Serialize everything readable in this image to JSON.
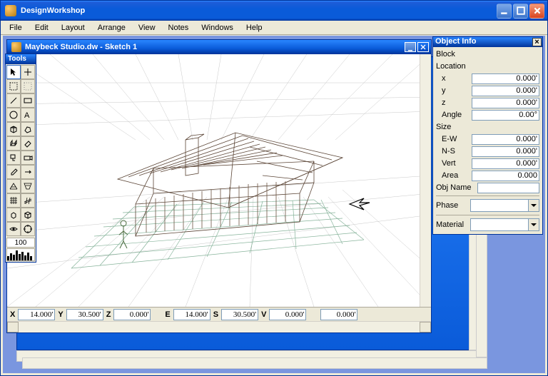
{
  "app": {
    "title": "DesignWorkshop"
  },
  "menu": [
    "File",
    "Edit",
    "Layout",
    "Arrange",
    "View",
    "Notes",
    "Windows",
    "Help"
  ],
  "doc": {
    "title": "Maybeck Studio.dw - Sketch 1"
  },
  "tools": {
    "title": "Tools",
    "alt_value": "100"
  },
  "status": {
    "x_label": "X",
    "x_value": "14.000'",
    "y_label": "Y",
    "y_value": "30.500'",
    "z_label": "Z",
    "z_value": "0.000'",
    "e_label": "E",
    "e_value": "14.000'",
    "s_label": "S",
    "s_value": "30.500'",
    "v_label": "V",
    "v_value": "0.000'",
    "extra_value": "0.000'"
  },
  "info": {
    "title": "Object Info",
    "type_label": "Block",
    "location_label": "Location",
    "loc_x_label": "x",
    "loc_x_value": "0.000'",
    "loc_y_label": "y",
    "loc_y_value": "0.000'",
    "loc_z_label": "z",
    "loc_z_value": "0.000'",
    "angle_label": "Angle",
    "angle_value": "0.00°",
    "size_label": "Size",
    "ew_label": "E-W",
    "ew_value": "0.000'",
    "ns_label": "N-S",
    "ns_value": "0.000'",
    "vert_label": "Vert",
    "vert_value": "0.000'",
    "area_label": "Area",
    "area_value": "0.000",
    "objname_label": "Obj Name",
    "objname_value": "",
    "phase_label": "Phase",
    "phase_value": "",
    "material_label": "Material",
    "material_value": ""
  }
}
